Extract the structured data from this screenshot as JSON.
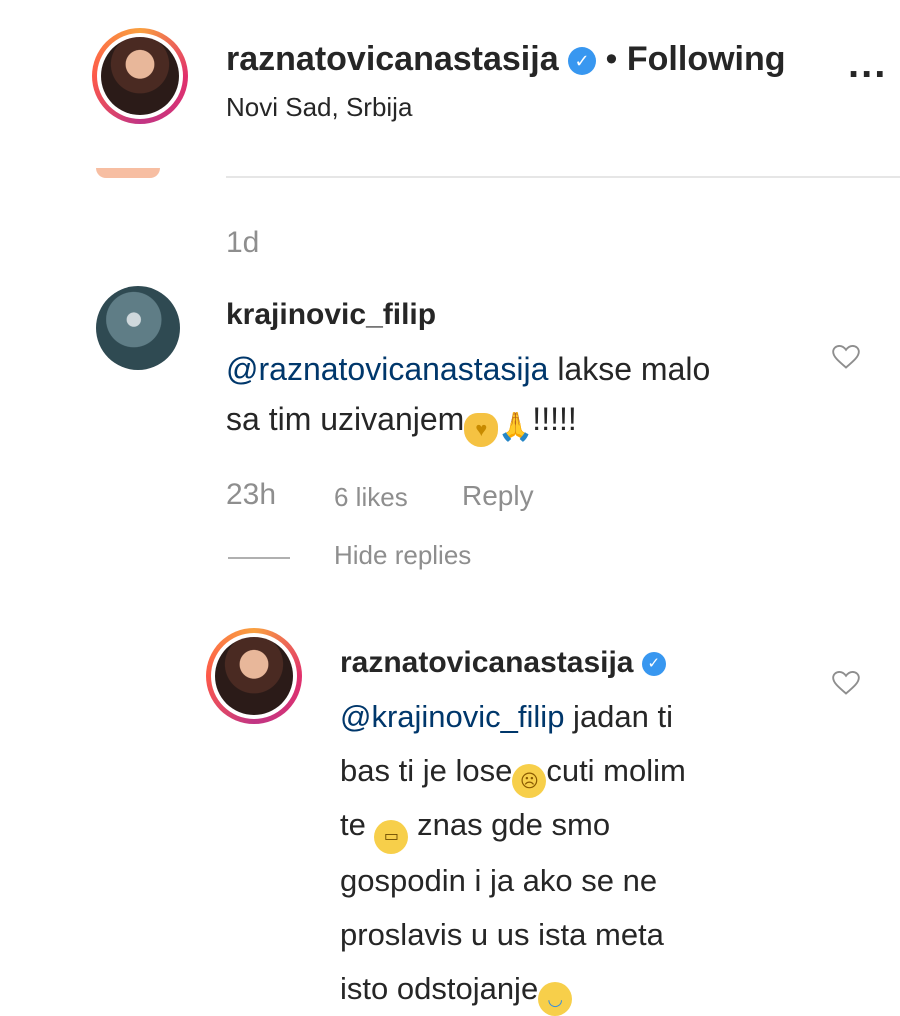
{
  "header": {
    "username": "raznatovicanastasija",
    "dot": "•",
    "follow_label": "Following",
    "location": "Novi Sad, Srbija",
    "more": "..."
  },
  "prev_comment": {
    "time": "1d"
  },
  "comment": {
    "username": "krajinovic_filip",
    "mention": "@raznatovicanastasija",
    "text_line1": " lakse malo",
    "text_line2": "sa tim uzivanjem",
    "text_suffix": "!!!!!",
    "time": "23h",
    "likes": "6 likes",
    "reply": "Reply",
    "hide_replies": "Hide replies"
  },
  "reply": {
    "username": "raznatovicanastasija",
    "mention": "@krajinovic_filip",
    "line1": " jadan ti",
    "line2a": "bas ti je lose",
    "line2b": "cuti molim",
    "line3a": "te ",
    "line3b": " znas gde smo",
    "line4": "gospodin i ja ako se ne",
    "line5": "proslavis u us ista meta",
    "line6": "isto odstojanje"
  },
  "icons": {
    "verified": "verified-badge-icon",
    "heart": "heart-outline-icon",
    "emoji_heart": "yellow-heart-emoji",
    "emoji_pray": "folded-hands-emoji",
    "emoji_sad": "sad-face-emoji",
    "emoji_grimace": "grimacing-face-emoji",
    "emoji_laugh": "tears-of-joy-emoji"
  },
  "colors": {
    "verified": "#3897f0",
    "mention": "#00376b",
    "meta": "#8e8e8e"
  }
}
